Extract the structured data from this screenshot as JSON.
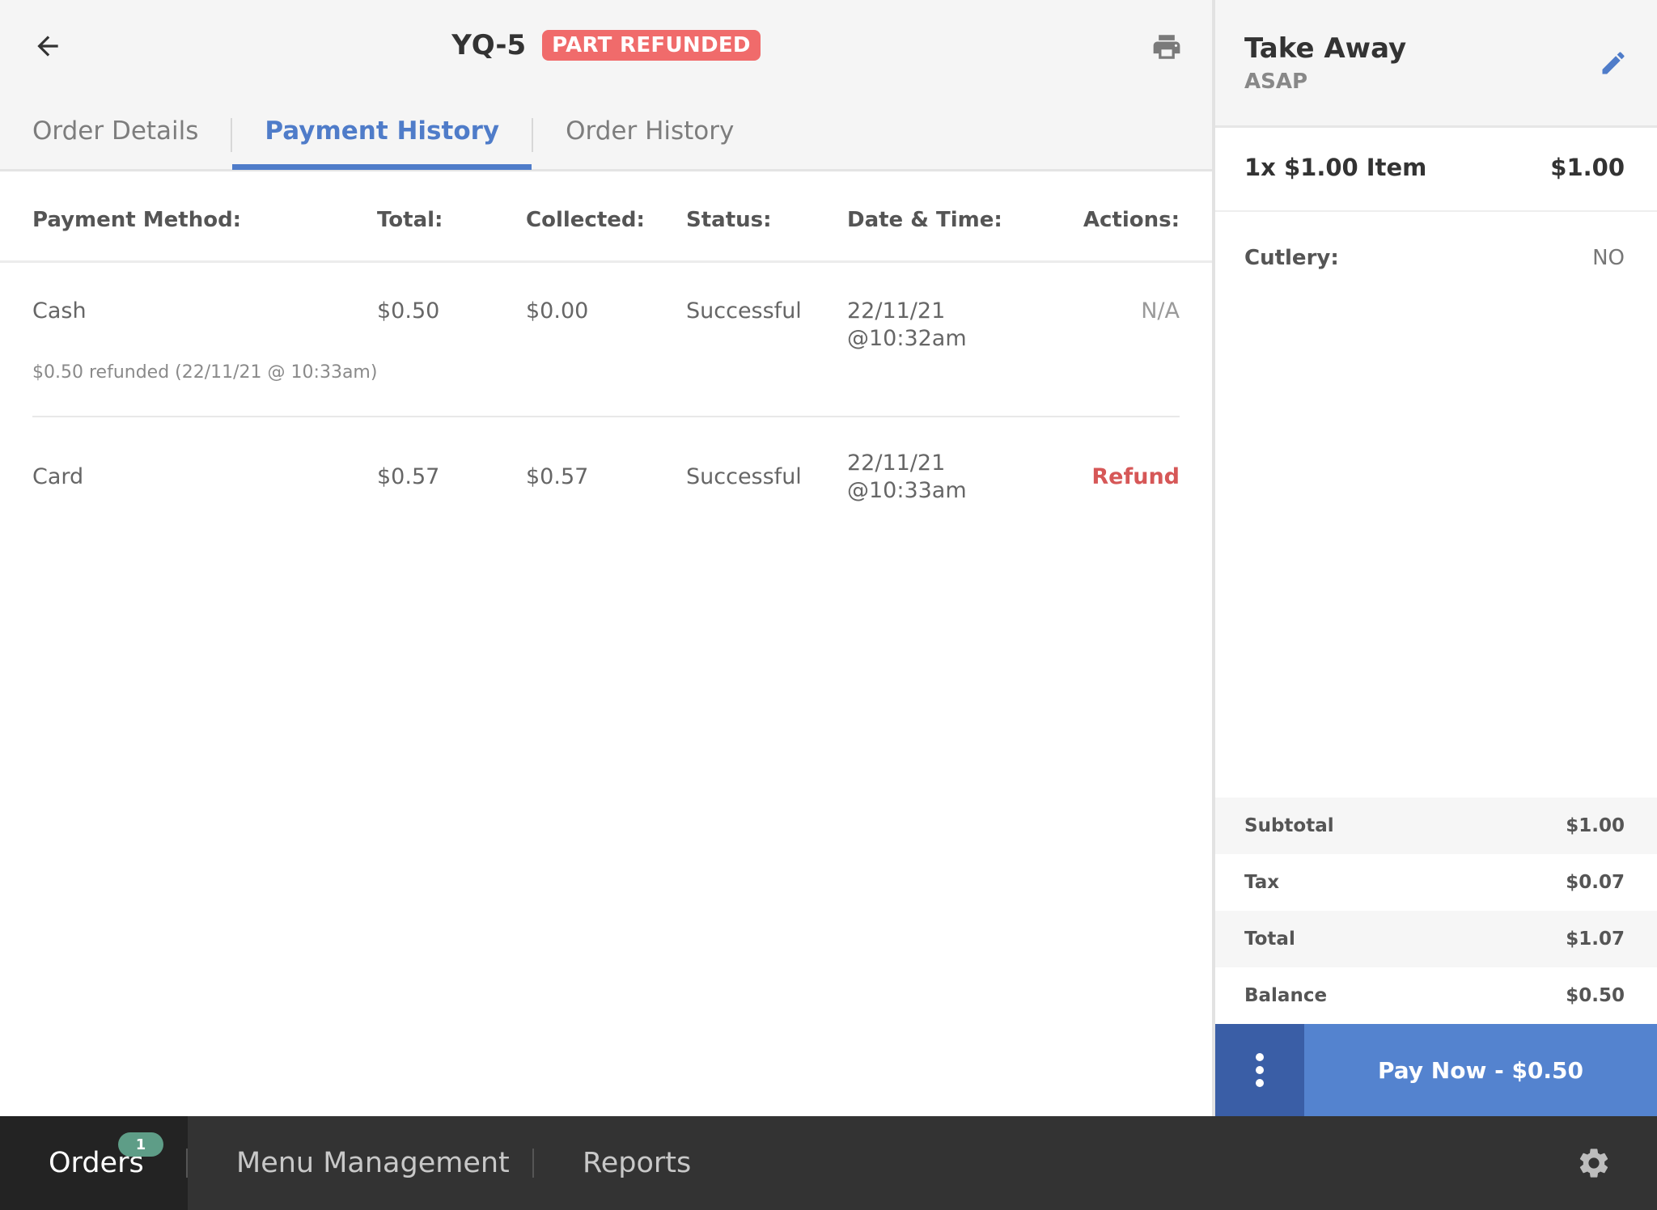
{
  "header": {
    "order_id": "YQ-5",
    "status_badge": "PART REFUNDED",
    "back_icon": "back-arrow-icon",
    "print_icon": "printer-icon"
  },
  "tabs": [
    {
      "label": "Order Details",
      "active": false
    },
    {
      "label": "Payment History",
      "active": true
    },
    {
      "label": "Order History",
      "active": false
    }
  ],
  "payments_table": {
    "headers": {
      "method": "Payment Method:",
      "total": "Total:",
      "collected": "Collected:",
      "status": "Status:",
      "datetime": "Date & Time:",
      "actions": "Actions:"
    },
    "rows": [
      {
        "method": "Cash",
        "total": "$0.50",
        "collected": "$0.00",
        "status": "Successful",
        "date": "22/11/21",
        "time": "@10:32am",
        "action": "N/A",
        "note": "$0.50 refunded (22/11/21 @ 10:33am)"
      },
      {
        "method": "Card",
        "total": "$0.57",
        "collected": "$0.57",
        "status": "Successful",
        "date": "22/11/21",
        "time": "@10:33am",
        "action": "Refund"
      }
    ]
  },
  "order_panel": {
    "type": "Take Away",
    "timing": "ASAP",
    "edit_icon": "pencil-icon",
    "items": [
      {
        "name": "1x $1.00 Item",
        "price": "$1.00"
      }
    ],
    "cutlery_label": "Cutlery:",
    "cutlery_value": "NO",
    "summary": [
      {
        "label": "Subtotal",
        "value": "$1.00"
      },
      {
        "label": "Tax",
        "value": "$0.07"
      },
      {
        "label": "Total",
        "value": "$1.07"
      },
      {
        "label": "Balance",
        "value": "$0.50"
      }
    ],
    "more_icon": "more-vertical-icon",
    "pay_button": "Pay Now - $0.50"
  },
  "bottom_nav": {
    "items": [
      {
        "label": "Orders",
        "active": true,
        "badge": "1"
      },
      {
        "label": "Menu Management",
        "active": false
      },
      {
        "label": "Reports",
        "active": false
      }
    ],
    "settings_icon": "gear-icon"
  },
  "colors": {
    "accent": "#4f7cc9",
    "badge_red": "#f06b6b",
    "refund_red": "#d65757",
    "pay_blue": "#5483cf",
    "more_blue": "#3a5ea6",
    "nav_dark": "#333333",
    "badge_green": "#5e9d87"
  }
}
